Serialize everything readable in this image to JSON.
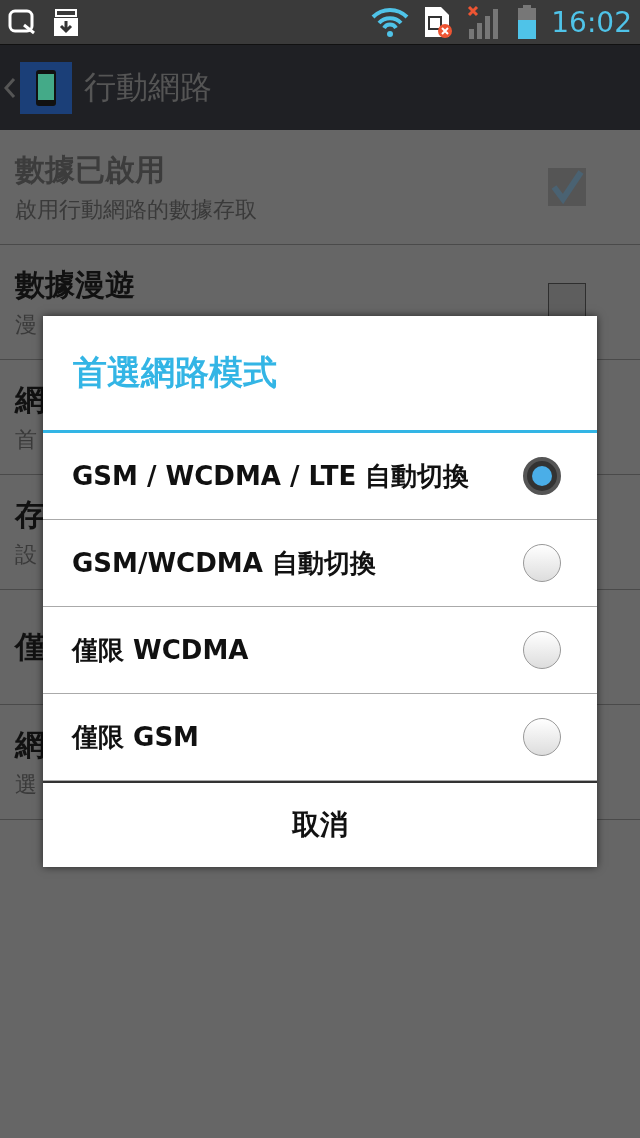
{
  "status_bar": {
    "time": "16:02"
  },
  "action_bar": {
    "title": "行動網路"
  },
  "settings": [
    {
      "title": "數據已啟用",
      "subtitle": "啟用行動網路的數據存取",
      "checked": true,
      "disabled": true
    },
    {
      "title": "數據漫遊",
      "subtitle": "漫",
      "checked": false,
      "disabled": false
    },
    {
      "title": "網",
      "subtitle": "首",
      "disabled": false
    },
    {
      "title": "存",
      "subtitle": "設",
      "disabled": false
    },
    {
      "title": "僅",
      "disabled": false
    },
    {
      "title": "網",
      "subtitle": "選",
      "disabled": false
    }
  ],
  "dialog": {
    "title": "首選網路模式",
    "options": [
      {
        "label": "GSM / WCDMA / LTE 自動切換",
        "selected": true
      },
      {
        "label": "GSM/WCDMA 自動切換",
        "selected": false
      },
      {
        "label": "僅限 WCDMA",
        "selected": false
      },
      {
        "label": "僅限 GSM",
        "selected": false
      }
    ],
    "button": "取消"
  }
}
